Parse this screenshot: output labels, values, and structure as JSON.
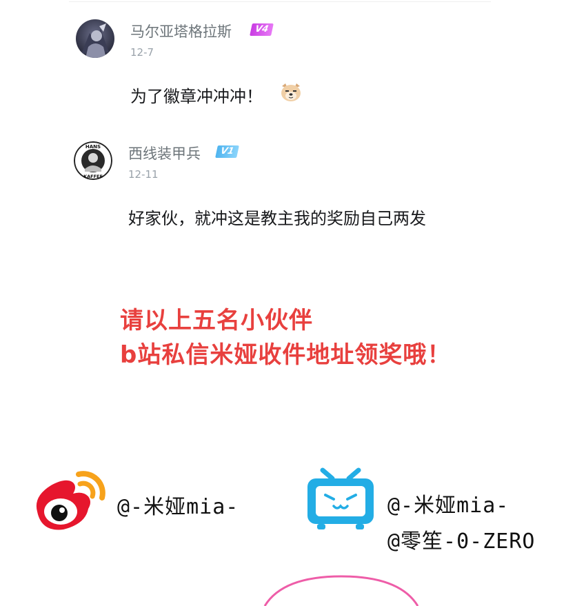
{
  "comments": [
    {
      "username": "马尔亚塔格拉斯",
      "level": "V4",
      "date": "12-7",
      "text": "为了徽章冲冲冲！",
      "emoji_icon": "dog-face-emoji"
    },
    {
      "username": "西线装甲兵",
      "level": "V1",
      "date": "12-11",
      "text": "好家伙，就冲这是教主我的奖励自己两发",
      "avatar_text_top": "HANS",
      "avatar_text_bottom": "KAFFEE"
    }
  ],
  "announcement": {
    "line1": "请以上五名小伙伴",
    "line2": "b站私信米娅收件地址领奖哦！"
  },
  "social": {
    "weibo_handle": "@-米娅mia-",
    "bilibili_handle_1": "@-米娅mia-",
    "bilibili_handle_2": "@零笙-0-ZERO"
  },
  "colors": {
    "announcement_red": "#e8403e",
    "weibo_red": "#e6162d",
    "weibo_orange": "#f7a21b",
    "bilibili_blue": "#23ade5",
    "v4_purple": "#c93de3",
    "v1_blue": "#4fb4ef"
  }
}
